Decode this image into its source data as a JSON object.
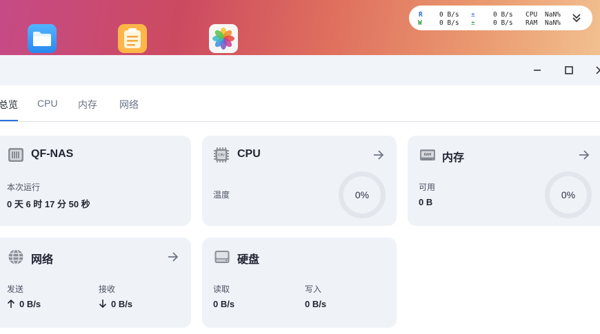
{
  "monitor": {
    "read_label": "R",
    "write_label": "W",
    "read_speed": "0 B/s",
    "write_speed": "0 B/s",
    "upload_speed": "0 B/s",
    "download_speed": "0 B/s",
    "upload_arrow": "±",
    "download_arrow": "±",
    "cpu_label": "CPU",
    "ram_label": "RAM",
    "cpu_value": "NaN%",
    "ram_value": "NaN%"
  },
  "desktop_icons": [
    "folder-icon",
    "notes-icon",
    "photos-icon"
  ],
  "tabs": [
    {
      "label": "总览",
      "active": true
    },
    {
      "label": "CPU"
    },
    {
      "label": "内存"
    },
    {
      "label": "网络"
    }
  ],
  "system": {
    "title": "QF-NAS",
    "uptime_label": "本次运行",
    "uptime_value": "0 天 6 时 17 分 50 秒"
  },
  "cpu": {
    "title": "CPU",
    "temp_label": "温度",
    "usage": "0%"
  },
  "memory": {
    "title": "内存",
    "available_label": "可用",
    "available_value": "0 B",
    "usage": "0%"
  },
  "network": {
    "title": "网络",
    "send_label": "发送",
    "send_value": "0 B/s",
    "receive_label": "接收",
    "receive_value": "0 B/s"
  },
  "disk": {
    "title": "硬盘",
    "read_label": "读取",
    "read_value": "0 B/s",
    "write_label": "写入",
    "write_value": "0 B/s"
  },
  "colors": {
    "accent": "#2f6de0",
    "card_bg": "#eff2f7"
  }
}
